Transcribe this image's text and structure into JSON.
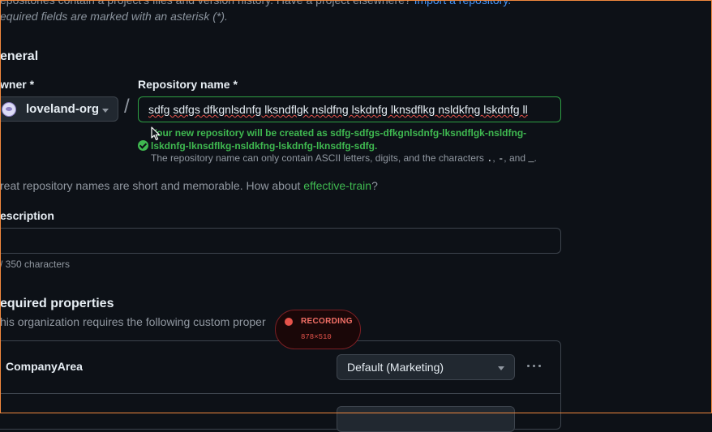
{
  "intro": {
    "line1_text": "epositories contain a project's files and version history. Have a project elsewhere? ",
    "line1_link": "Import a repository.",
    "line2": "equired fields are marked with an asterisk (*)."
  },
  "general": {
    "heading": "eneral",
    "owner_label": "wner *",
    "owner_value": "loveland-org",
    "separator": "/",
    "repo_label": "Repository name *",
    "repo_value": "sdfg sdfgs dfkgnlsdnfg lksndflgk nsldfng lskdnfg lknsdflkg nsldkfng lskdnfg ll",
    "success_message": "Your new repository will be created as sdfg-sdfgs-dfkgnlsdnfg-lksndflgk-nsldfng-lskdnfg-lknsdflkg-nsldkfng-lskdnfg-lknsdfg-sdfg.",
    "helper_prefix": "The repository name can only contain ASCII letters, digits, and the characters ",
    "helper_c1": ".",
    "helper_sep1": ", ",
    "helper_c2": "-",
    "helper_sep2": ", and ",
    "helper_c3": "_",
    "helper_suffix": ".",
    "suggest_prefix": "reat repository names are short and memorable. How about ",
    "suggest_name": "effective-train",
    "suggest_suffix": "?"
  },
  "description": {
    "label": "escription",
    "value": "",
    "char_count": "/ 350 characters"
  },
  "properties": {
    "heading": "equired properties",
    "desc": "his organization requires the following custom proper",
    "items": [
      {
        "name": "CompanyArea",
        "value": "Default (Marketing)"
      }
    ]
  },
  "recording": {
    "label": "RECORDING",
    "size": "878×510"
  },
  "colors": {
    "background": "#0d1117",
    "success": "#3fb950",
    "link": "#4493f8",
    "recording": "#e5534b"
  }
}
